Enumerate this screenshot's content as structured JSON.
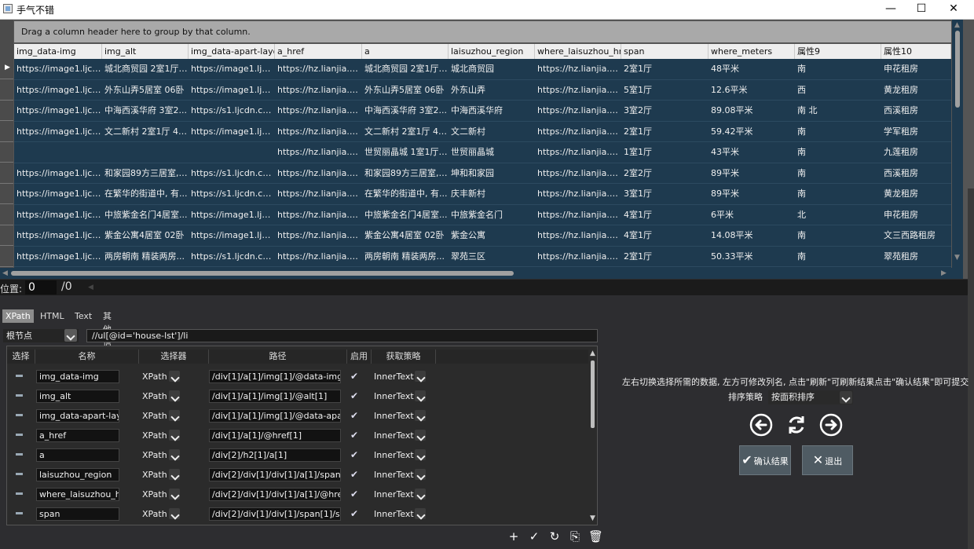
{
  "window": {
    "title": "手气不错",
    "minimize_glyph": "—",
    "maximize_glyph": "☐",
    "close_glyph": "✕"
  },
  "grid": {
    "group_hint": "Drag a column header here to group by that column.",
    "columns": [
      "img_data-img",
      "img_alt",
      "img_data-apart-layout",
      "a_href",
      "a",
      "laisuzhou_region",
      "where_laisuzhou_href",
      "span",
      "where_meters",
      "属性9",
      "属性10"
    ],
    "rows": [
      [
        "https://image1.ljcdn.com/...",
        "城北商贸园 2室1厅 3...",
        "https://image1.ljcdn.com/...",
        "https://hz.lianjia.com/...",
        "城北商贸园 2室1厅 3...",
        "城北商贸园",
        "https://hz.lianjia.com/...",
        "2室1厅",
        "48平米",
        "南",
        "申花租房"
      ],
      [
        "https://image1.ljcdn.com/...",
        "外东山弄5居室 06卧",
        "https://image1.ljcdn.com/...",
        "https://hz.lianjia.com/...",
        "外东山弄5居室 06卧",
        "外东山弄",
        "https://hz.lianjia.com/...",
        "5室1厅",
        "12.6平米",
        "西",
        "黄龙租房"
      ],
      [
        "https://image1.ljcdn.com/...",
        "中海西溪华府 3室2...",
        "https://s1.ljcdn.com/...",
        "https://hz.lianjia.com/...",
        "中海西溪华府 3室2...",
        "中海西溪华府",
        "https://hz.lianjia.com/...",
        "3室2厅",
        "89.08平米",
        "南 北",
        "西溪租房"
      ],
      [
        "https://image1.ljcdn.com/...",
        "文二新村 2室1厅 450...",
        "https://image1.ljcdn.com/...",
        "https://hz.lianjia.com/...",
        "文二新村 2室1厅 450...",
        "文二新村",
        "https://hz.lianjia.com/...",
        "2室1厅",
        "59.42平米",
        "南",
        "学军租房"
      ],
      [
        "",
        "",
        "",
        "https://hz.lianjia.com/...",
        "世贸丽晶城 1室1厅 4...",
        "世贸丽晶城",
        "https://hz.lianjia.com/...",
        "1室1厅",
        "43平米",
        "南",
        "九莲租房"
      ],
      [
        "https://image1.ljcdn.com/...",
        "和家园89方三居室, ...",
        "https://s1.ljcdn.com/...",
        "https://hz.lianjia.com/...",
        "和家园89方三居室, ...",
        "坤和和家园",
        "https://hz.lianjia.com/...",
        "2室2厅",
        "89平米",
        "南",
        "西溪租房"
      ],
      [
        "https://image1.ljcdn.com/...",
        "在繁华的街道中, 有...",
        "https://s1.ljcdn.com/...",
        "https://hz.lianjia.com/...",
        "在繁华的街道中, 有...",
        "庆丰新村",
        "https://hz.lianjia.com/...",
        "3室1厅",
        "89平米",
        "南",
        "黄龙租房"
      ],
      [
        "https://image1.ljcdn.com/...",
        "中旅紫金名门4居室...",
        "https://image1.ljcdn.com/...",
        "https://hz.lianjia.com/...",
        "中旅紫金名门4居室...",
        "中旅紫金名门",
        "https://hz.lianjia.com/...",
        "4室1厅",
        "6平米",
        "北",
        "申花租房"
      ],
      [
        "https://image1.ljcdn.com/...",
        "紫金公寓4居室 02卧",
        "https://image1.ljcdn.com/...",
        "https://hz.lianjia.com/...",
        "紫金公寓4居室 02卧",
        "紫金公寓",
        "https://hz.lianjia.com/...",
        "4室1厅",
        "14.08平米",
        "南",
        "文三西路租房"
      ],
      [
        "https://image1.ljcdn.com/...",
        "两房朝南 精装两房...",
        "https://s1.ljcdn.com/...",
        "https://hz.lianjia.com/...",
        "两房朝南 精装两房...",
        "翠苑三区",
        "https://hz.lianjia.com/...",
        "2室1厅",
        "50.33平米",
        "南",
        "翠苑租房"
      ]
    ],
    "current_row_indicator": "▶"
  },
  "position": {
    "label": "位置:",
    "value": "0",
    "total": "/0"
  },
  "tabs": [
    "XPath",
    "HTML",
    "Text",
    "其他信息"
  ],
  "root": {
    "label": "根节点",
    "xpath": "//ul[@id='house-lst']/li"
  },
  "fields": {
    "headers": [
      "选择",
      "名称",
      "选择器",
      "路径",
      "启用",
      "获取策略"
    ],
    "rows": [
      {
        "name": "img_data-img",
        "selector": "XPath",
        "path": "/div[1]/a[1]/img[1]/@data-img[",
        "enabled": "✔",
        "strategy": "InnerText"
      },
      {
        "name": "img_alt",
        "selector": "XPath",
        "path": "/div[1]/a[1]/img[1]/@alt[1]",
        "enabled": "✔",
        "strategy": "InnerText"
      },
      {
        "name": "img_data-apart-layout",
        "selector": "XPath",
        "path": "/div[1]/a[1]/img[1]/@data-apart",
        "enabled": "✔",
        "strategy": "InnerText"
      },
      {
        "name": "a_href",
        "selector": "XPath",
        "path": "/div[1]/a[1]/@href[1]",
        "enabled": "✔",
        "strategy": "InnerText"
      },
      {
        "name": "a",
        "selector": "XPath",
        "path": "/div[2]/h2[1]/a[1]",
        "enabled": "✔",
        "strategy": "InnerText"
      },
      {
        "name": "laisuzhou_region",
        "selector": "XPath",
        "path": "/div[2]/div[1]/div[1]/a[1]/span[1",
        "enabled": "✔",
        "strategy": "InnerText"
      },
      {
        "name": "where_laisuzhou_href",
        "selector": "XPath",
        "path": "/div[2]/div[1]/div[1]/a[1]/@href[",
        "enabled": "✔",
        "strategy": "InnerText"
      },
      {
        "name": "span",
        "selector": "XPath",
        "path": "/div[2]/div[1]/div[1]/span[1]/spa",
        "enabled": "✔",
        "strategy": "InnerText"
      }
    ]
  },
  "tools": {
    "add": "+",
    "check": "✓",
    "redo": "↻",
    "export": "⎘",
    "delete": "🗑"
  },
  "right_panel": {
    "hint": "左右切换选择所需的数据, 左方可修改列名, 点击\"刷新\"可刷新结果点击\"确认结果\"即可提交",
    "sort_label": "排序策略",
    "sort_value": "按面积排序",
    "confirm_label": "确认结果",
    "exit_label": "退出",
    "confirm_glyph": "✔",
    "exit_glyph": "✕"
  }
}
